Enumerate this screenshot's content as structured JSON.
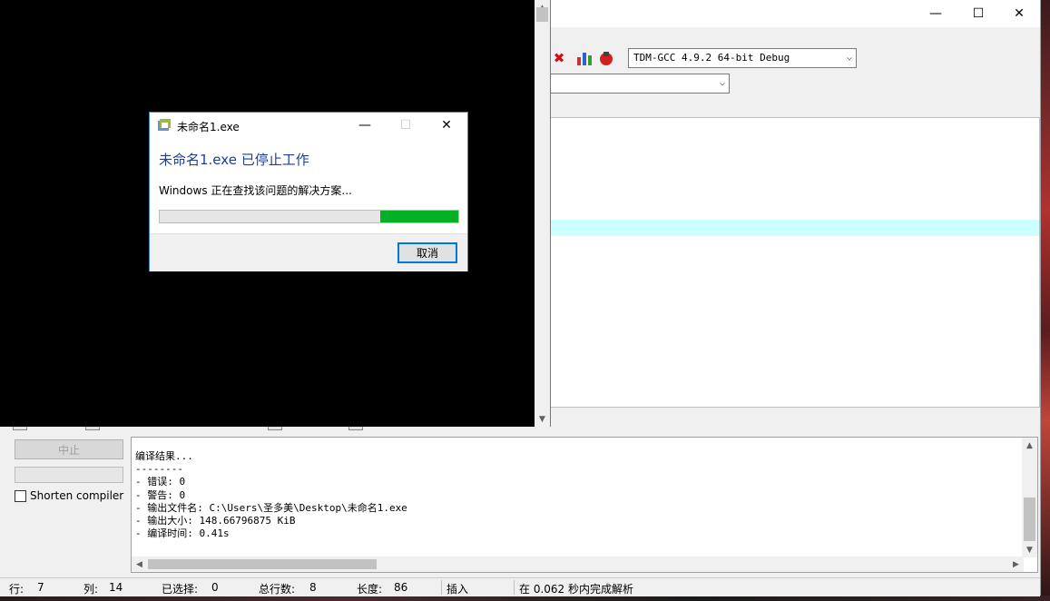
{
  "ide": {
    "compiler_select": "TDM-GCC 4.9.2 64-bit Debug",
    "second_select": "",
    "window_controls": {
      "minimize": "—",
      "maximize": "☐",
      "close": "✕"
    }
  },
  "compiler_panel": {
    "stop_button": "中止",
    "shorten_label": "Shorten compiler pa",
    "log_lines": [
      "编译结果...",
      "--------",
      "- 错误: 0",
      "- 警告: 0",
      "- 输出文件名: C:\\Users\\圣多美\\Desktop\\未命名1.exe",
      "- 输出大小: 148.66796875 KiB",
      "- 编译时间: 0.41s"
    ]
  },
  "statusbar": {
    "line_label": "行:",
    "line_value": "7",
    "col_label": "列:",
    "col_value": "14",
    "sel_label": "已选择:",
    "sel_value": "0",
    "total_label": "总行数:",
    "total_value": "8",
    "len_label": "长度:",
    "len_value": "86",
    "mode": "插入",
    "parse_msg": "在 0.062 秒内完成解析"
  },
  "dialog": {
    "title": "未命名1.exe",
    "heading": "未命名1.exe 已停止工作",
    "message": "Windows 正在查找该问题的解决方案...",
    "cancel_button": "取消",
    "progress_fraction": 0.26,
    "progress_color": "#06b025"
  }
}
